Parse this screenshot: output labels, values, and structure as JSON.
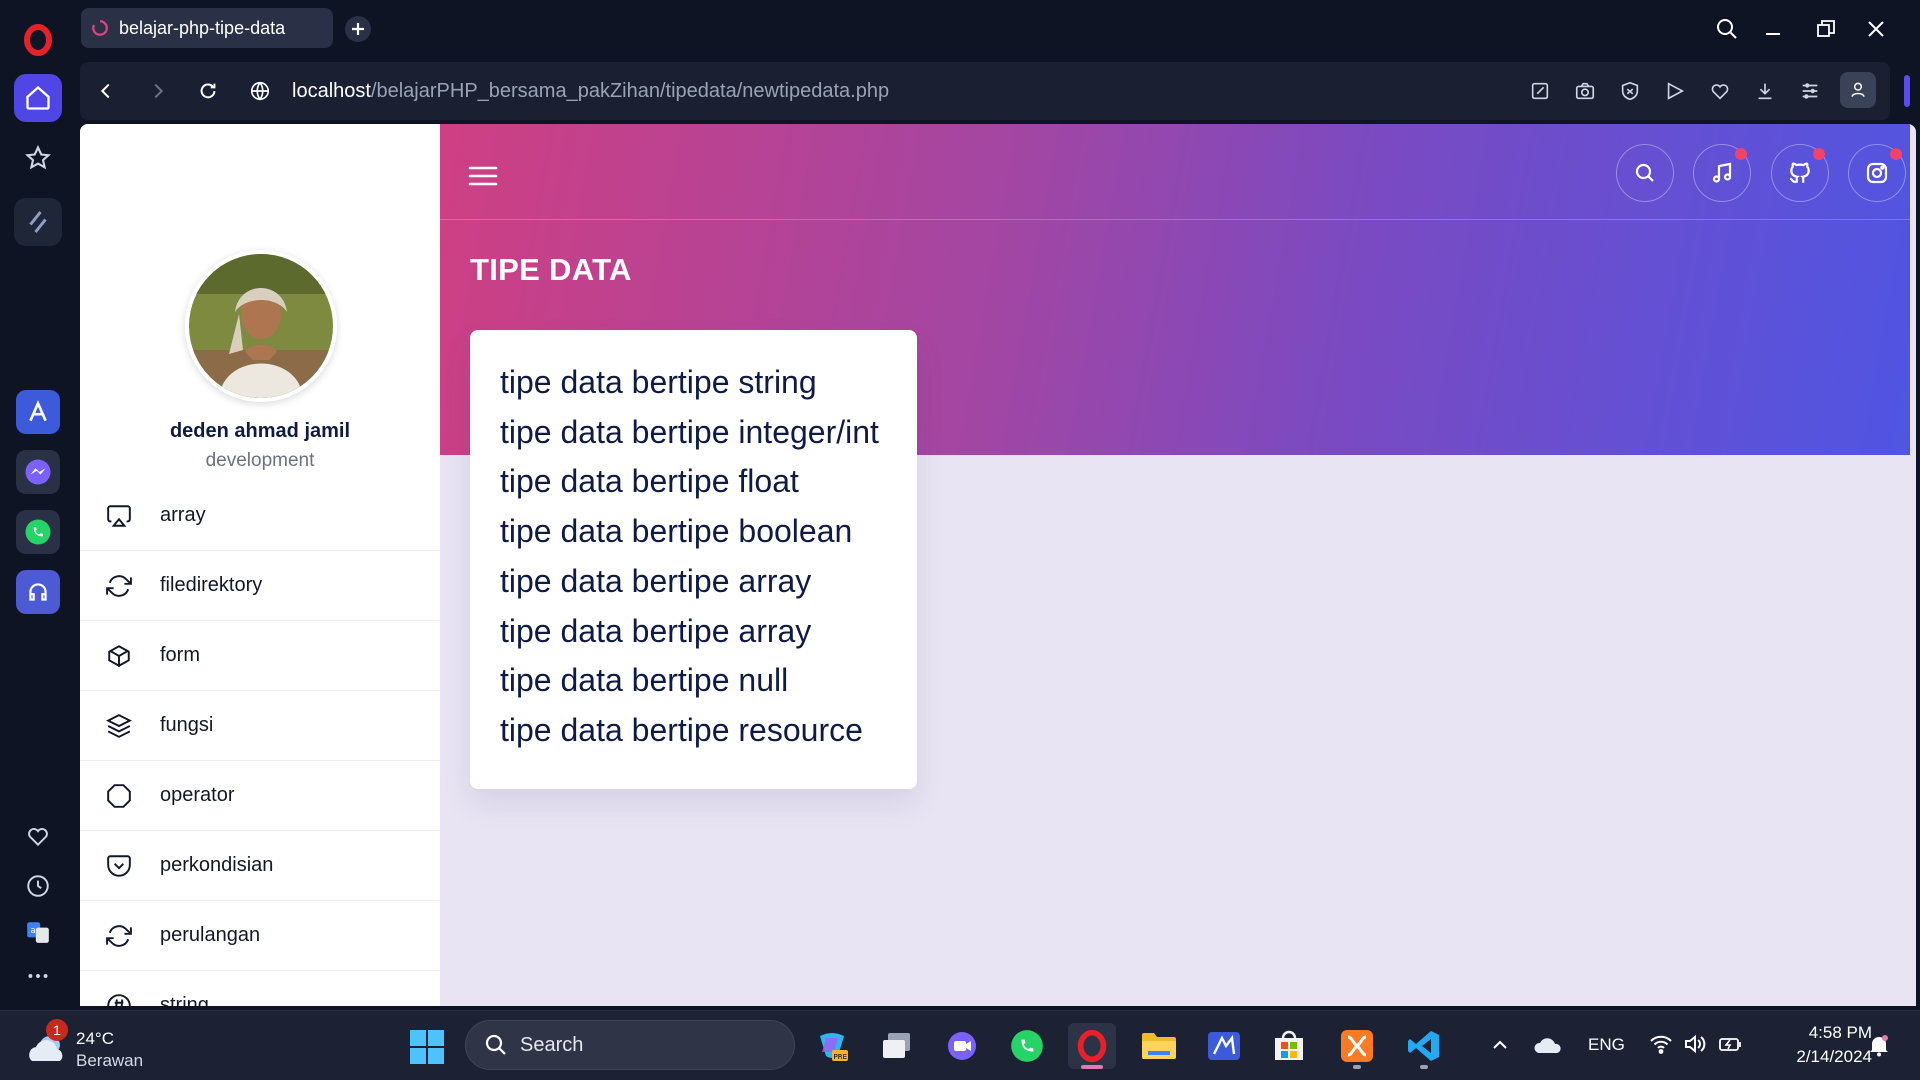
{
  "browser": {
    "tab_title": "belajar-php-tipe-data",
    "url_host": "localhost",
    "url_path": "/belajarPHP_bersama_pakZihan/tipedata/newtipedata.php"
  },
  "page": {
    "title": "TIPE DATA",
    "profile": {
      "name": "deden ahmad jamil",
      "role": "development"
    },
    "menu": [
      {
        "label": "array",
        "icon": "airplay-icon"
      },
      {
        "label": "filedirektory",
        "icon": "refresh-icon"
      },
      {
        "label": "form",
        "icon": "box-icon"
      },
      {
        "label": "fungsi",
        "icon": "layers-icon"
      },
      {
        "label": "operator",
        "icon": "octagon-icon"
      },
      {
        "label": "perkondisian",
        "icon": "pocket-icon"
      },
      {
        "label": "perulangan",
        "icon": "refresh-icon"
      },
      {
        "label": "string",
        "icon": "hash-icon"
      }
    ],
    "types": [
      "tipe data bertipe string",
      "tipe data bertipe integer/int",
      "tipe data bertipe float",
      "tipe data bertipe boolean",
      "tipe data bertipe array",
      "tipe data bertipe array",
      "tipe data bertipe null",
      "tipe data bertipe resource"
    ],
    "top_icons": [
      "search-icon",
      "music-icon",
      "github-icon",
      "instagram-icon"
    ]
  },
  "taskbar": {
    "weather_temp": "24°C",
    "weather_desc": "Berawan",
    "weather_badge": "1",
    "search_placeholder": "Search",
    "language": "ENG",
    "time": "4:58 PM",
    "date": "2/14/2024"
  },
  "colors": {
    "hero_start": "#cf3f83",
    "hero_end": "#4f55e3",
    "accent": "#4f46e5",
    "text_dark": "#0f1b45"
  }
}
